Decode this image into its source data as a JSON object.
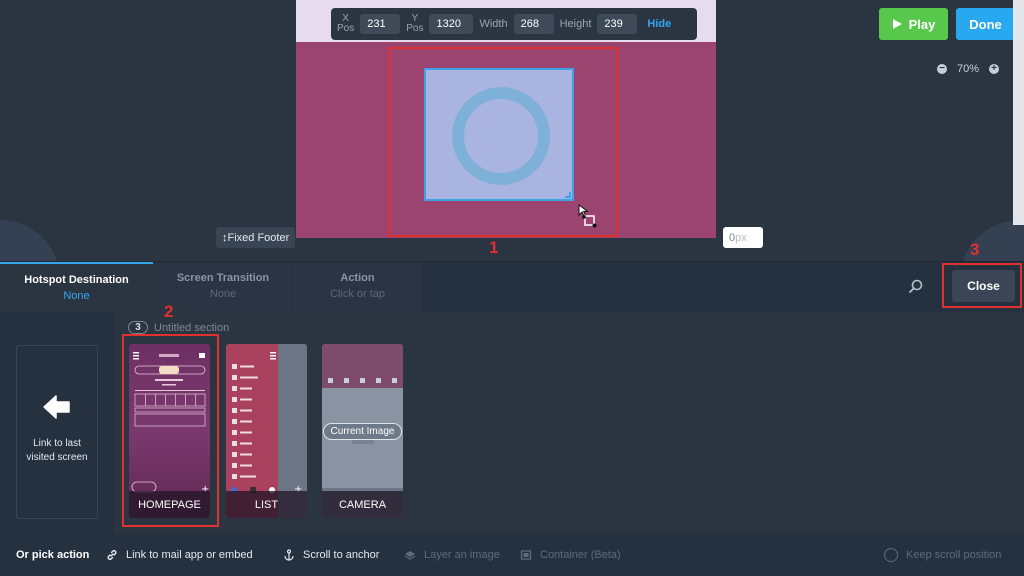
{
  "position_toolbar": {
    "x_label_top": "X",
    "x_label_bottom": "Pos",
    "x_value": "231",
    "y_label_top": "Y",
    "y_label_bottom": "Pos",
    "y_value": "1320",
    "width_label": "Width",
    "width_value": "268",
    "height_label": "Height",
    "height_value": "239",
    "hide_label": "Hide"
  },
  "canvas": {
    "fixed_footer_label": "↕Fixed Footer",
    "px_value": "0",
    "px_unit": "px"
  },
  "header_actions": {
    "play_label": "Play",
    "done_label": "Done"
  },
  "zoom": {
    "minus": "−",
    "level": "70%",
    "plus": "+"
  },
  "annotations": {
    "n1": "1",
    "n2": "2",
    "n3": "3"
  },
  "tabs": [
    {
      "title": "Hotspot Destination",
      "subtitle": "None"
    },
    {
      "title": "Screen Transition",
      "subtitle": "None"
    },
    {
      "title": "Action",
      "subtitle": "Click or tap"
    }
  ],
  "close_label": "Close",
  "link_last": {
    "label": "Link to last visited screen"
  },
  "section": {
    "count": "3",
    "name": "Untitled section"
  },
  "screens": [
    {
      "name": "HOMEPAGE"
    },
    {
      "name": "LIST"
    },
    {
      "name": "CAMERA",
      "tag": "Current Image"
    }
  ],
  "bottom_actions": {
    "or_pick": "Or pick action",
    "mail": "Link to mail app or embed",
    "scroll": "Scroll to anchor",
    "layer": "Layer an image",
    "container": "Container (Beta)",
    "keep_scroll": "Keep scroll position"
  },
  "colors": {
    "background": "#2b3542",
    "accent_blue": "#32a7ee",
    "play_green": "#58c84d",
    "annotation_red": "#e0312f",
    "artboard": "#9a446f"
  }
}
